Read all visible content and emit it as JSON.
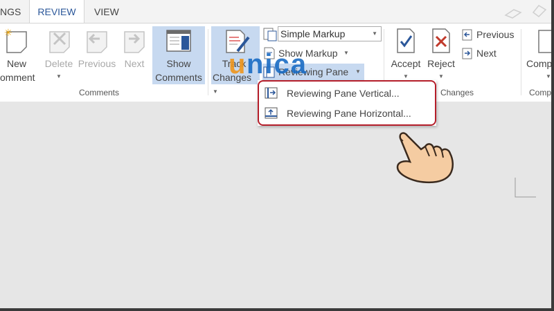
{
  "tabs": [
    {
      "label": "NGS"
    },
    {
      "label": "REVIEW"
    },
    {
      "label": "VIEW"
    }
  ],
  "comments_group": {
    "new_comment_l1": "New",
    "new_comment_l2": "omment",
    "delete": "Delete",
    "previous": "Previous",
    "next": "Next",
    "show_comments_l1": "Show",
    "show_comments_l2": "Comments",
    "label": "Comments"
  },
  "tracking_group": {
    "track_changes_l1": "Track",
    "track_changes_l2": "Changes",
    "markup_select": "Simple Markup",
    "show_markup": "Show Markup",
    "reviewing_pane": "Reviewing Pane"
  },
  "changes_group": {
    "accept": "Accept",
    "reject": "Reject",
    "previous": "Previous",
    "next": "Next",
    "label": "Changes"
  },
  "compare_group": {
    "compare": "Comp",
    "label": "Comp"
  },
  "dropdown": {
    "vertical": "Reviewing Pane Vertical...",
    "horizontal": "Reviewing Pane Horizontal..."
  },
  "watermark": "unica",
  "colors": {
    "accent": "#2b579a",
    "highlight": "#c7d9f0",
    "callout": "#b51e2a"
  }
}
